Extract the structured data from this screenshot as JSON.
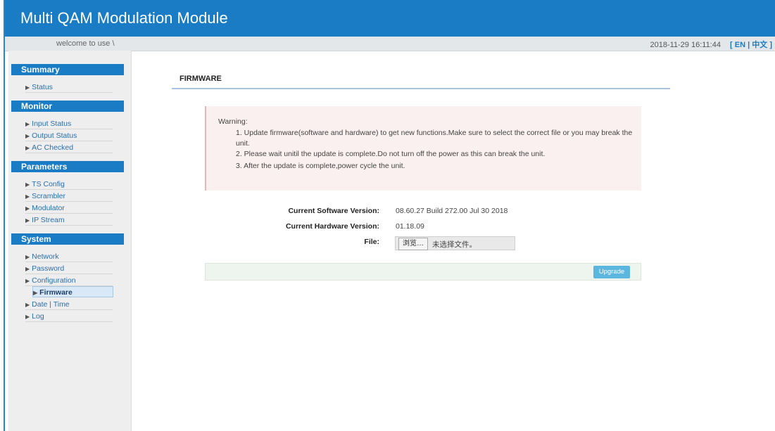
{
  "app": {
    "title": "Multi QAM Modulation Module"
  },
  "subbar": {
    "welcome": "welcome to use \\",
    "datetime": "2018-11-29 16:11:44",
    "lang_open": "[",
    "lang_en": "EN",
    "lang_sep": "|",
    "lang_zh": "中文",
    "lang_close": "]"
  },
  "sidebar": {
    "summary": {
      "title": "Summary",
      "items": [
        "Status"
      ]
    },
    "monitor": {
      "title": "Monitor",
      "items": [
        "Input Status",
        "Output Status",
        "AC Checked"
      ]
    },
    "parameters": {
      "title": "Parameters",
      "items": [
        "TS Config",
        "Scrambler",
        "Modulator",
        "IP Stream"
      ]
    },
    "system": {
      "title": "System",
      "items": [
        "Network",
        "Password",
        "Configuration",
        "Firmware",
        "Date | Time",
        "Log"
      ],
      "active": "Firmware"
    }
  },
  "page": {
    "title": "FIRMWARE",
    "warning": {
      "label": "Warning:",
      "lines": [
        "1. Update firmware(software and hardware) to get new functions.Make sure to select the correct file or you may break the unit.",
        "2. Please wait unitil the update is complete.Do not turn off the power as this can break the unit.",
        "3. After the update is complete,power cycle the unit."
      ]
    },
    "software_label": "Current Software Version:",
    "software_value": "08.60.27 Build 272.00 Jul 30 2018",
    "hardware_label": "Current Hardware Version:",
    "hardware_value": "01.18.09",
    "file_label": "File:",
    "file_button": "浏览…",
    "file_status": "未选择文件。",
    "upgrade_button": "Upgrade"
  },
  "colors": {
    "accent": "#1a7cc4",
    "upgrade": "#5bb6e0",
    "warning_bg": "#fbf0f0"
  }
}
